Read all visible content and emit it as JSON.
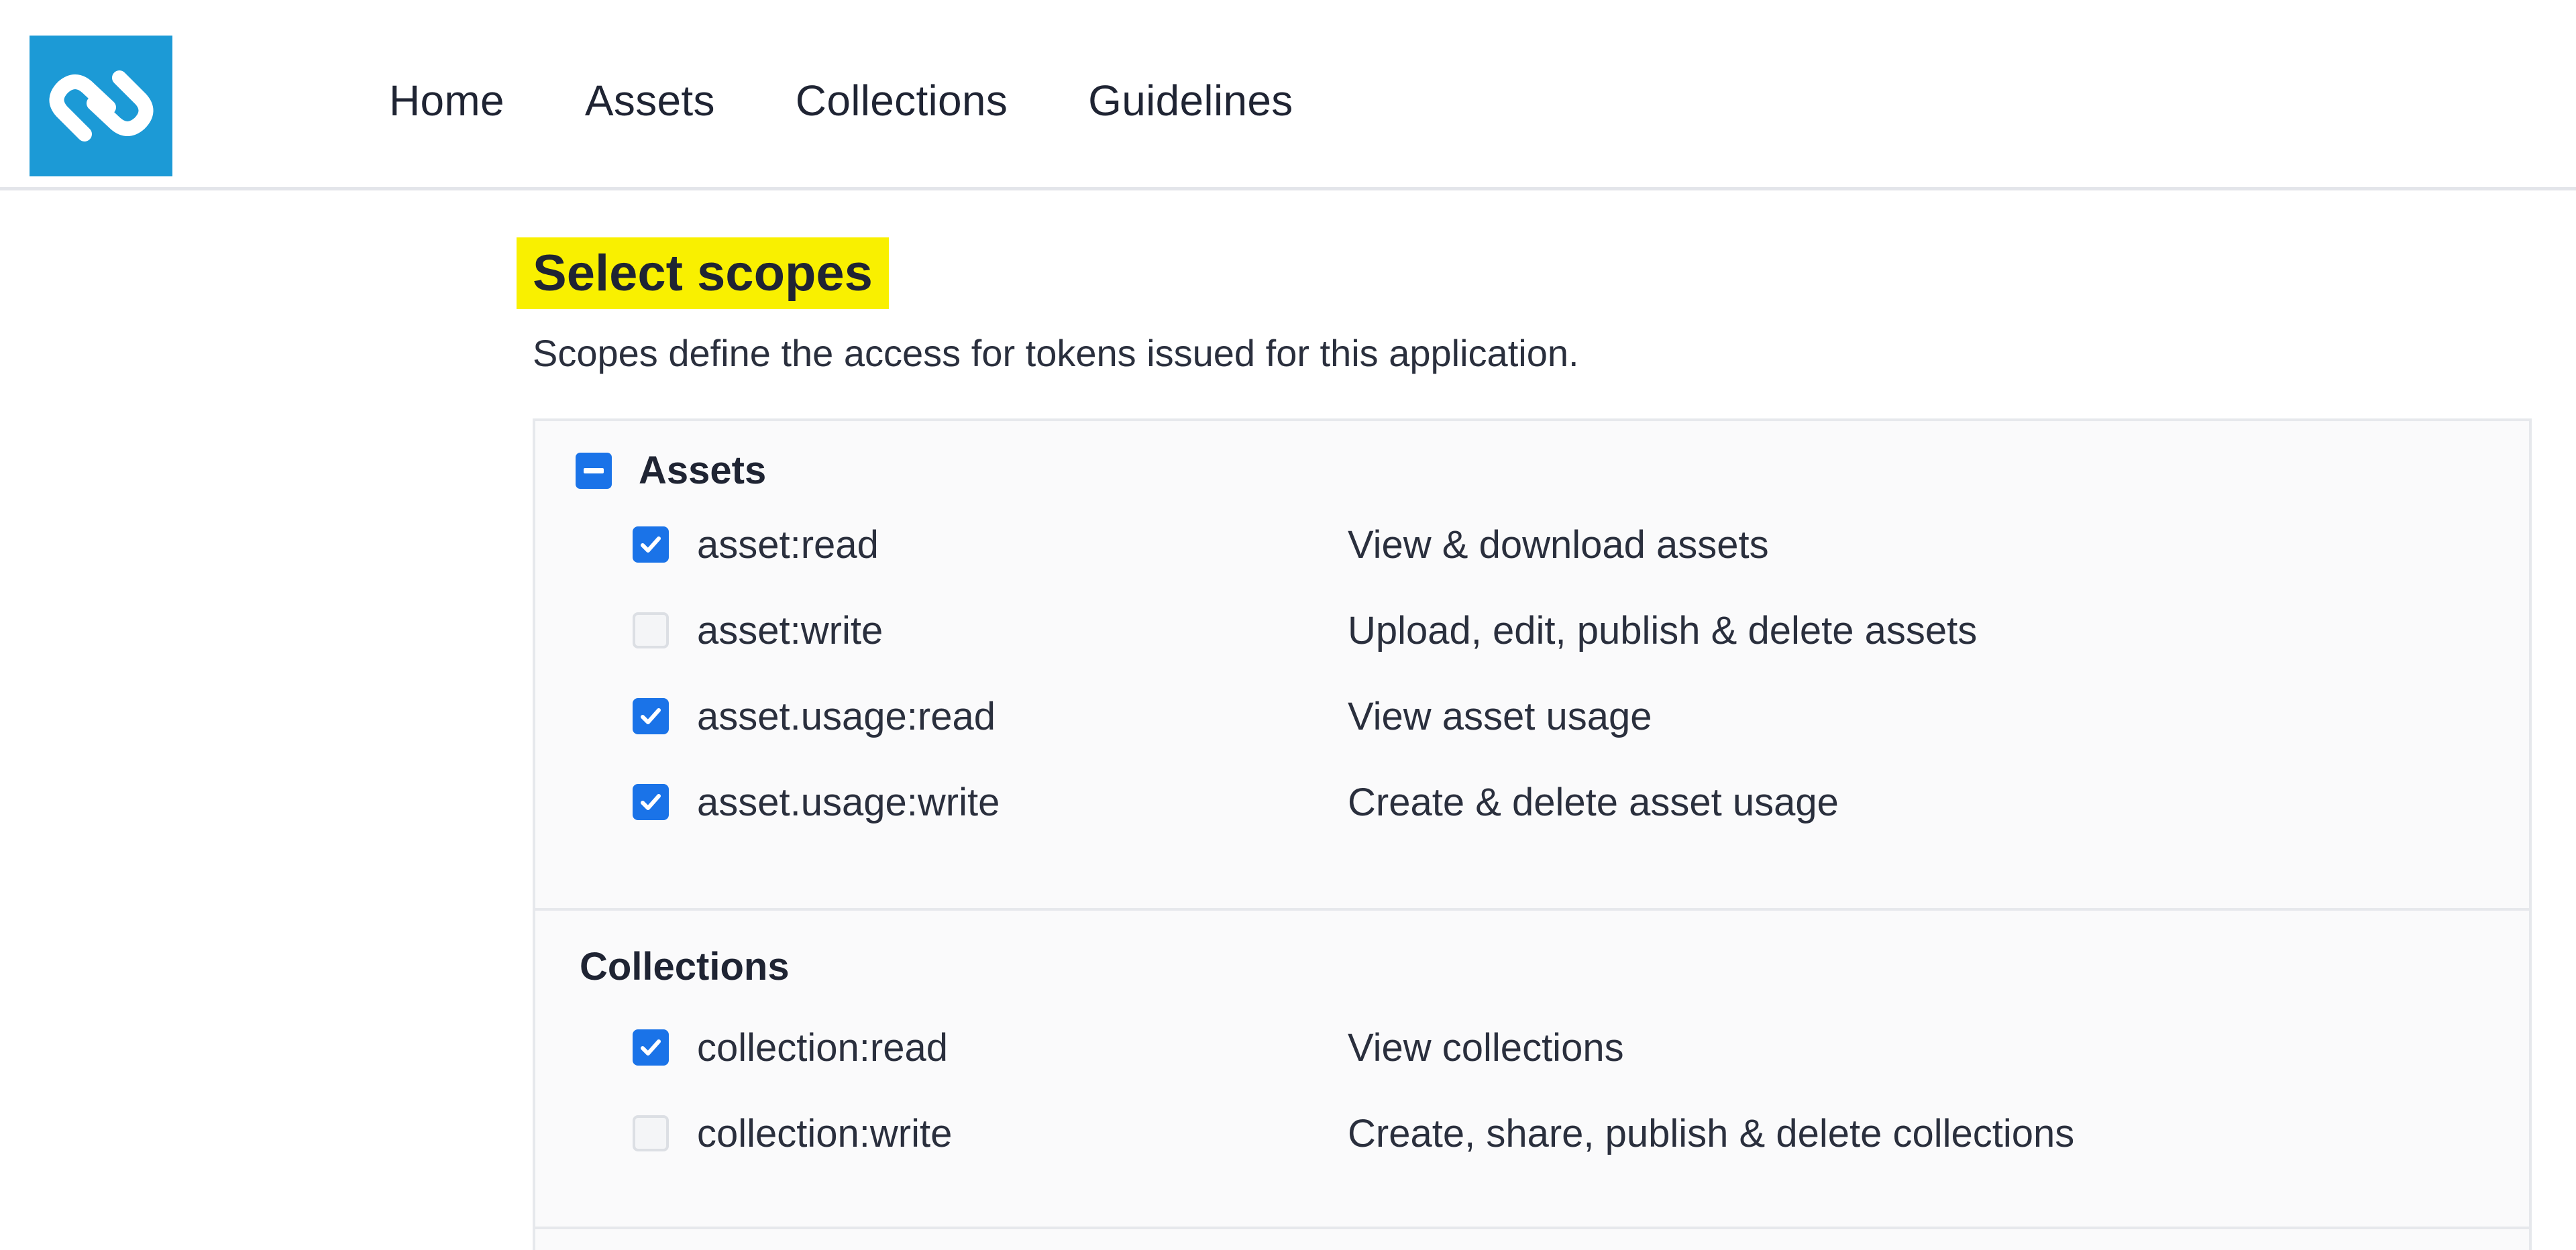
{
  "nav": {
    "items": [
      "Home",
      "Assets",
      "Collections",
      "Guidelines"
    ]
  },
  "colors": {
    "logo": "#1c9ad6",
    "highlight": "#f9f000",
    "checkbox_checked": "#1a73e8"
  },
  "page": {
    "title": "Select scopes",
    "subtitle": "Scopes define the access for tokens issued for this application."
  },
  "groups": [
    {
      "title": "Assets",
      "state": "indeterminate",
      "scopes": [
        {
          "name": "asset:read",
          "description": "View & download assets",
          "checked": true
        },
        {
          "name": "asset:write",
          "description": "Upload, edit, publish & delete assets",
          "checked": false
        },
        {
          "name": "asset.usage:read",
          "description": "View asset usage",
          "checked": true
        },
        {
          "name": "asset.usage:write",
          "description": "Create & delete asset usage",
          "checked": true
        }
      ]
    },
    {
      "title": "Collections",
      "scopes": [
        {
          "name": "collection:read",
          "description": "View collections",
          "checked": true
        },
        {
          "name": "collection:write",
          "description": "Create, share, publish & delete collections",
          "checked": false
        }
      ]
    }
  ]
}
